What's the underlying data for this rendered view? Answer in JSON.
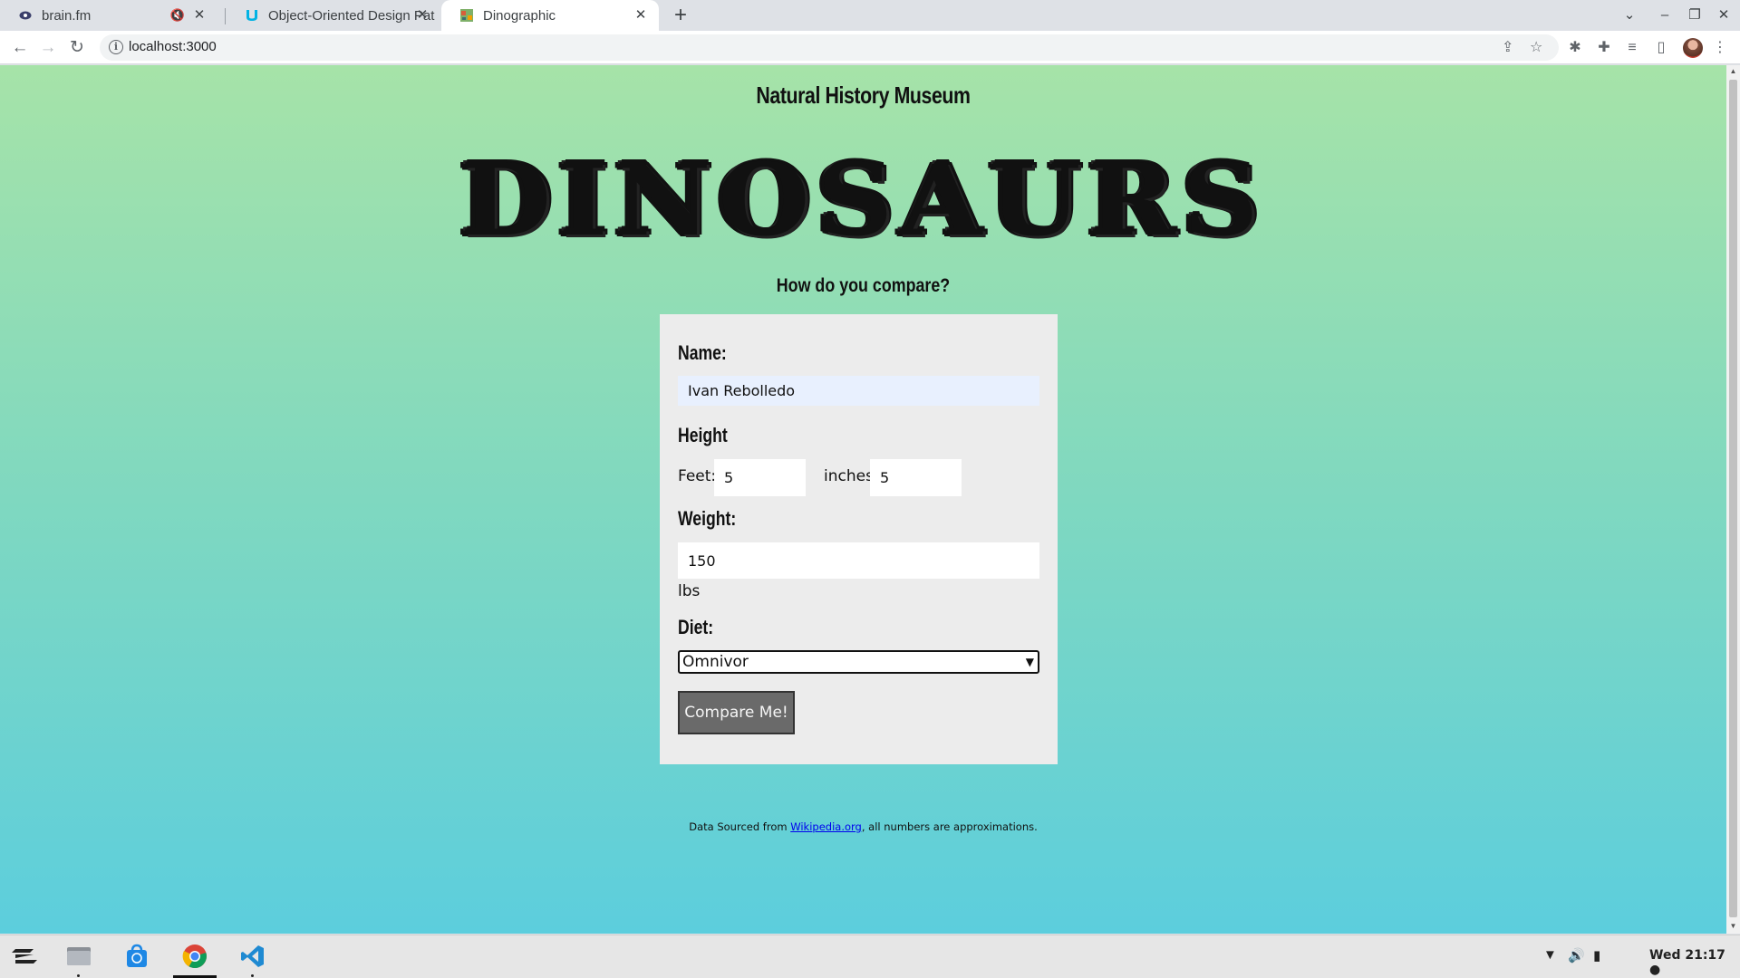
{
  "browser": {
    "tabs": [
      {
        "title": "brain.fm",
        "icon": "brainfm-icon",
        "muted": true
      },
      {
        "title": "Object-Oriented Design Pat",
        "icon": "udacity-icon",
        "muted": false
      },
      {
        "title": "Dinographic",
        "icon": "dinographic-icon",
        "muted": false,
        "active": true
      }
    ],
    "url": "localhost:3000"
  },
  "page": {
    "museum_title": "Natural History Museum",
    "hero_title": "DINOSAURS",
    "question": "How do you compare?",
    "form": {
      "name_label": "Name:",
      "name_value": "Ivan Rebolledo",
      "height_label": "Height",
      "feet_label": "Feet:",
      "feet_value": "5",
      "inches_label": "inches:",
      "inches_value": "5",
      "weight_label": "Weight:",
      "weight_value": "150",
      "weight_unit": "lbs",
      "diet_label": "Diet:",
      "diet_selected": "Omnivor",
      "submit_label": "Compare Me!"
    },
    "footer": {
      "prefix": "Data Sourced from ",
      "link_text": "Wikipedia.org",
      "suffix": ", all numbers are approximations."
    }
  },
  "taskbar": {
    "apps": [
      "zorin-menu-icon",
      "files-icon",
      "software-store-icon",
      "chrome-icon",
      "vscode-icon"
    ],
    "clock": "Wed 21:17"
  },
  "colors": {
    "gradient_top": "#a6e3a8",
    "gradient_bottom": "#5ccedd",
    "card": "#ececec",
    "button": "#6a6a6a"
  }
}
